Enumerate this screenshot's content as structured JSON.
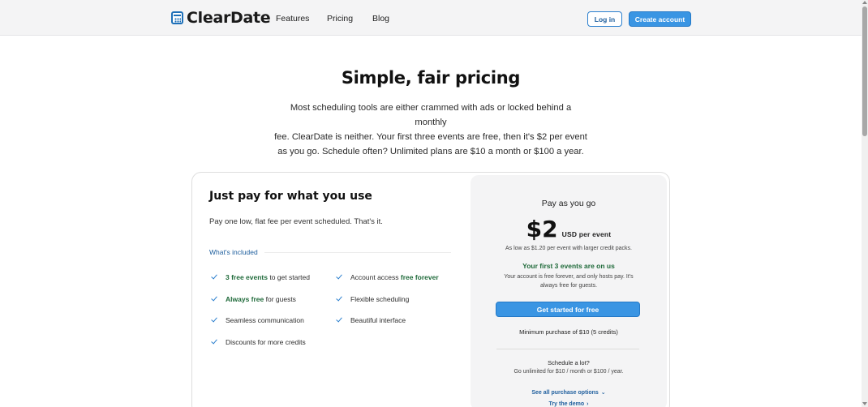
{
  "nav": {
    "logo_text": "ClearDate",
    "links": [
      "Features",
      "Pricing",
      "Blog"
    ],
    "login_label": "Log in",
    "create_label": "Create account"
  },
  "hero": {
    "title": "Simple, fair pricing",
    "desc_lines": [
      "Most scheduling tools are either crammed with ads or locked behind a monthly",
      "fee. ClearDate is neither. Your first three events are free, then it's $2 per event",
      "as you go. Schedule often? Unlimited plans are $10 a month or $100 a year."
    ]
  },
  "plan": {
    "title": "Just pay for what you use",
    "subtitle": "Pay one low, flat fee per event scheduled. That's it.",
    "included_label": "What's included",
    "features_left": [
      {
        "bold": "3 free events",
        "rest": " to get started",
        "bold_first": true
      },
      {
        "bold": "Always free",
        "rest": " for guests",
        "bold_first": true
      },
      {
        "bold": "",
        "rest": "Seamless communication",
        "bold_first": true
      },
      {
        "bold": "",
        "rest": "Discounts for more credits",
        "bold_first": true
      }
    ],
    "features_right": [
      {
        "pre": "Account access ",
        "bold": "free forever"
      },
      {
        "pre": "Flexible scheduling",
        "bold": ""
      },
      {
        "pre": "Beautiful interface",
        "bold": ""
      }
    ]
  },
  "pane": {
    "title": "Pay as you go",
    "price": "$2",
    "price_unit": "USD per event",
    "as_low": "As low as $1.20 per event with larger credit packs.",
    "first3": "Your first 3 events are on us",
    "free_note": "Your account is free forever, and only hosts pay. It's always free for guests.",
    "start_label": "Get started for free",
    "min_purchase": "Minimum purchase of $10 (5 credits)",
    "schedule_lot": "Schedule a lot?",
    "unlimited": "Go unlimited for $10 / month or $100 / year.",
    "link_purchase": "See all purchase options",
    "link_demo": "Try the demo"
  },
  "colors": {
    "accent": "#3a95e3",
    "link": "#1f5f9e",
    "green": "#1f6a3a"
  },
  "icons": [
    "calendar-logo-icon",
    "check-icon",
    "chevron-down-icon"
  ]
}
